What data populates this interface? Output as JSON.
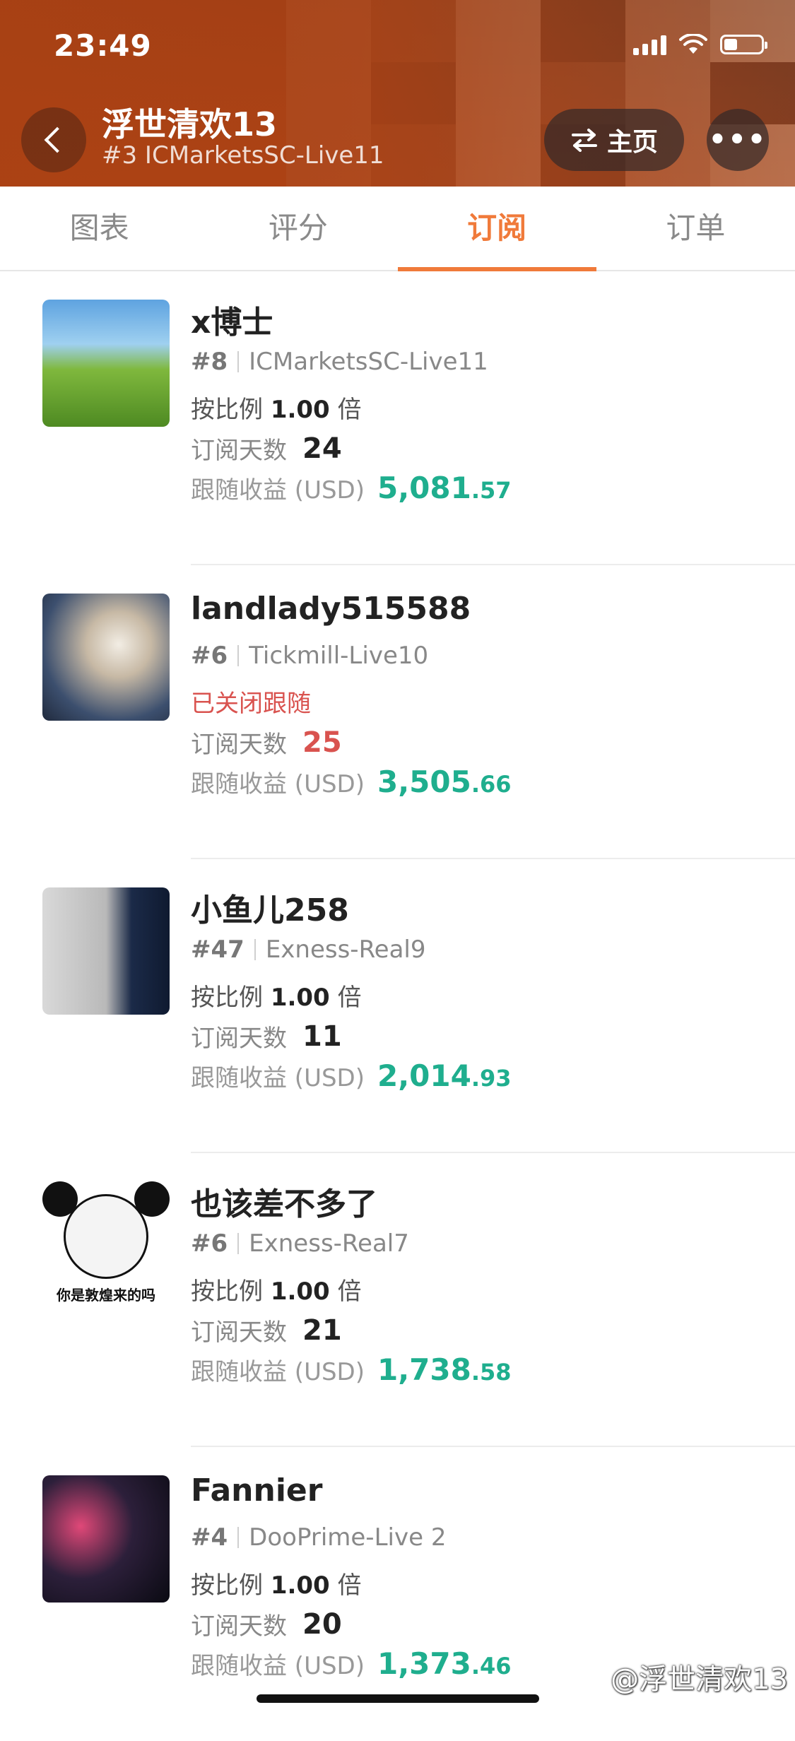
{
  "status_bar": {
    "time": "23:49"
  },
  "header": {
    "title": "浮世清欢13",
    "subtitle": "#3 ICMarketsSC-Live11",
    "home_label": "主页",
    "more_label": "•••"
  },
  "tabs": [
    {
      "label": "图表"
    },
    {
      "label": "评分"
    },
    {
      "label": "订阅",
      "active": true
    },
    {
      "label": "订单"
    }
  ],
  "labels": {
    "ratio_prefix": "按比例",
    "ratio_suffix": "倍",
    "days_label": "订阅天数",
    "profit_label": "跟随收益 (USD)"
  },
  "subscribers": [
    {
      "name": "x博士",
      "rank": "#8",
      "server": "ICMarketsSC-Live11",
      "ratio": "1.00",
      "days": "24",
      "profit_int": "5,081",
      "profit_dec": ".57",
      "avatar": "landscape"
    },
    {
      "name": "landlady515588",
      "rank": "#6",
      "server": "Tickmill-Live10",
      "status": "已关闭跟随",
      "days": "25",
      "days_highlight": true,
      "profit_int": "3,505",
      "profit_dec": ".66",
      "avatar": "cat"
    },
    {
      "name": "小鱼儿258",
      "rank": "#47",
      "server": "Exness-Real9",
      "ratio": "1.00",
      "days": "11",
      "profit_int": "2,014",
      "profit_dec": ".93",
      "avatar": "person"
    },
    {
      "name": "也该差不多了",
      "rank": "#6",
      "server": "Exness-Real7",
      "ratio": "1.00",
      "days": "21",
      "profit_int": "1,738",
      "profit_dec": ".58",
      "avatar": "panda-meme",
      "avatar_caption": "你是敦煌来的吗"
    },
    {
      "name": "Fannier",
      "rank": "#4",
      "server": "DooPrime-Live 2",
      "ratio": "1.00",
      "days": "20",
      "profit_int": "1,373",
      "profit_dec": ".46",
      "avatar": "car-interior"
    }
  ],
  "watermark": "@浮世清欢13",
  "colors": {
    "accent": "#f07a3a",
    "profit": "#1fae8e",
    "alert": "#d9534f",
    "header": "#b8461a"
  }
}
